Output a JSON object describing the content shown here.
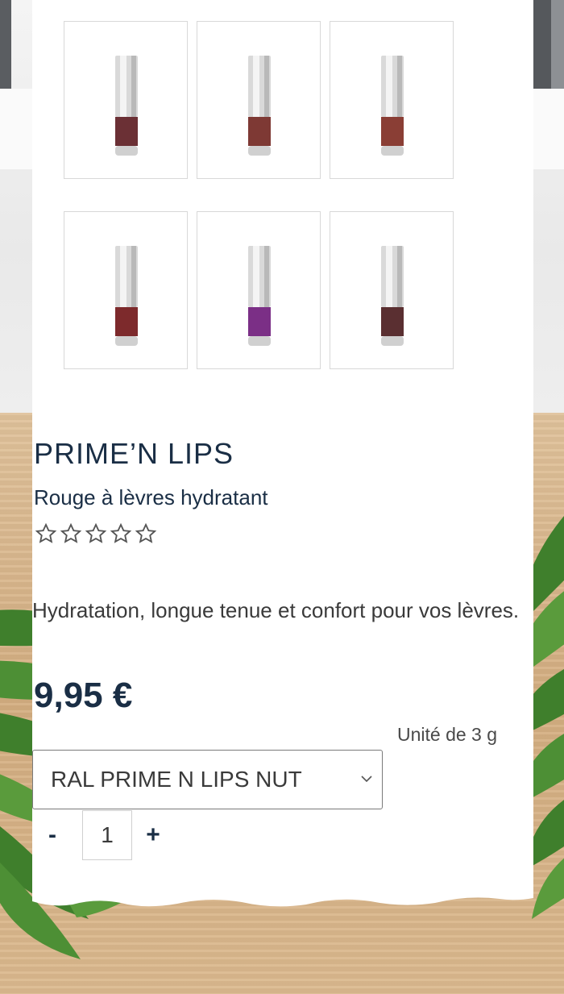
{
  "product": {
    "title": "PRIME’N LIPS",
    "subtitle": "Rouge à lèvres hydratant",
    "rating": {
      "value": 0,
      "max": 5
    },
    "description": "Hydratation, longue tenue et confort pour vos lèvres.",
    "price": "9,95 €",
    "unit": "Unité de 3 g"
  },
  "thumbnails": [
    {
      "shade_color": "#6b3035",
      "icon": "lipstick"
    },
    {
      "shade_color": "#7e3934",
      "icon": "lipstick"
    },
    {
      "shade_color": "#8a3e35",
      "icon": "lipstick"
    },
    {
      "shade_color": "#7d2a2c",
      "icon": "lipstick"
    },
    {
      "shade_color": "#7b2f86",
      "icon": "lipstick"
    },
    {
      "shade_color": "#5a2f31",
      "icon": "lipstick"
    }
  ],
  "variant_select": {
    "selected": "RAL PRIME N LIPS NUT"
  },
  "quantity": {
    "minus_label": "-",
    "value": "1",
    "plus_label": "+"
  },
  "colors": {
    "brand_navy": "#1a2e45",
    "card_bg": "#ffffff"
  }
}
